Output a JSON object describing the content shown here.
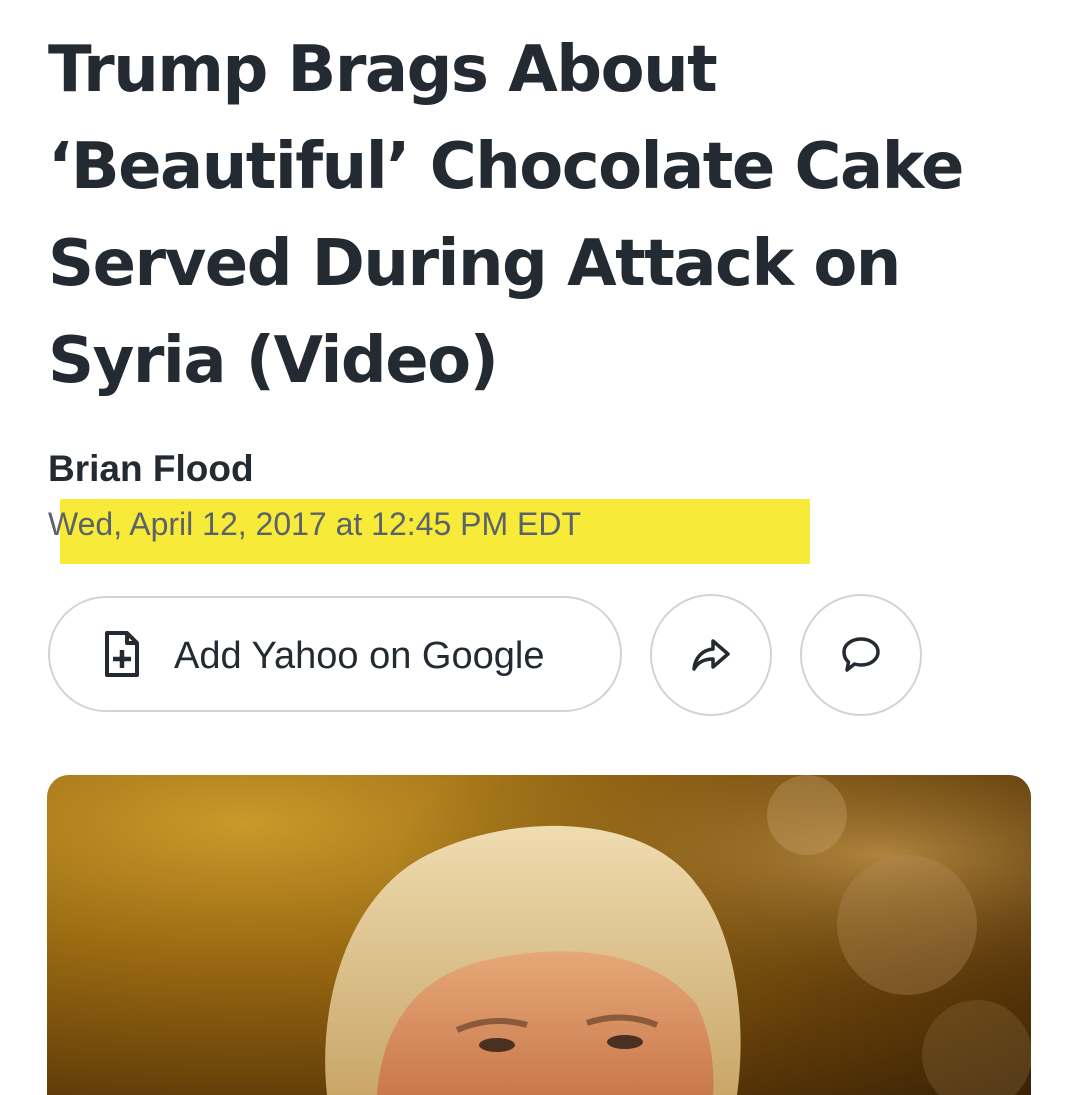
{
  "article": {
    "headline": "Trump Brags About ‘Beautiful’ Chocolate Cake Served During Attack on Syria (Video)",
    "author": "Brian Flood",
    "timestamp": "Wed, April 12, 2017 at 12:45 PM EDT"
  },
  "actions": {
    "add_source_label": "Add Yahoo on Google",
    "add_source_icon": "doc-plus-icon",
    "share_icon": "share-arrow-icon",
    "comment_icon": "comment-bubble-icon"
  },
  "colors": {
    "text": "#232a31",
    "highlight": "#f7ea38",
    "border": "#d0d4d8"
  }
}
